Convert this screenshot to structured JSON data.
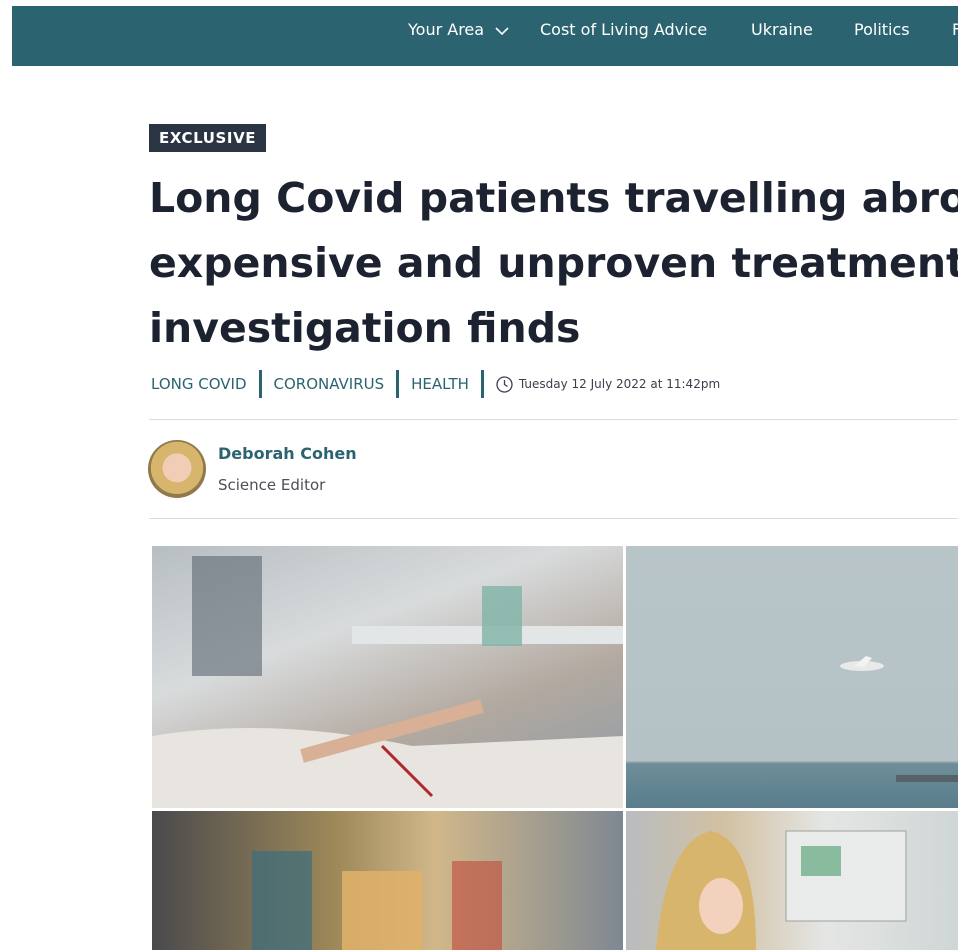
{
  "nav": {
    "items": [
      {
        "label": "Your Area",
        "has_dropdown": true
      },
      {
        "label": "Cost of Living Advice"
      },
      {
        "label": "Ukraine"
      },
      {
        "label": "Politics"
      },
      {
        "label": "F"
      }
    ]
  },
  "article": {
    "badge": "EXCLUSIVE",
    "headline_lines": [
      "Long Covid patients travelling abroad fo",
      "expensive and unproven treatments,",
      "investigation finds"
    ],
    "tags": [
      "LONG COVID",
      "CORONAVIRUS",
      "HEALTH"
    ],
    "timestamp": "Tuesday 12 July 2022 at 11:42pm",
    "author": {
      "name": "Deborah Cohen",
      "role": "Science Editor"
    }
  },
  "icons": {
    "nav_dropdown": "chevron-down-icon",
    "timestamp": "clock-icon"
  },
  "colors": {
    "nav_bg": "#2b6470",
    "accent": "#2b6470",
    "badge_bg": "#2a3442",
    "text": "#1c2230"
  }
}
